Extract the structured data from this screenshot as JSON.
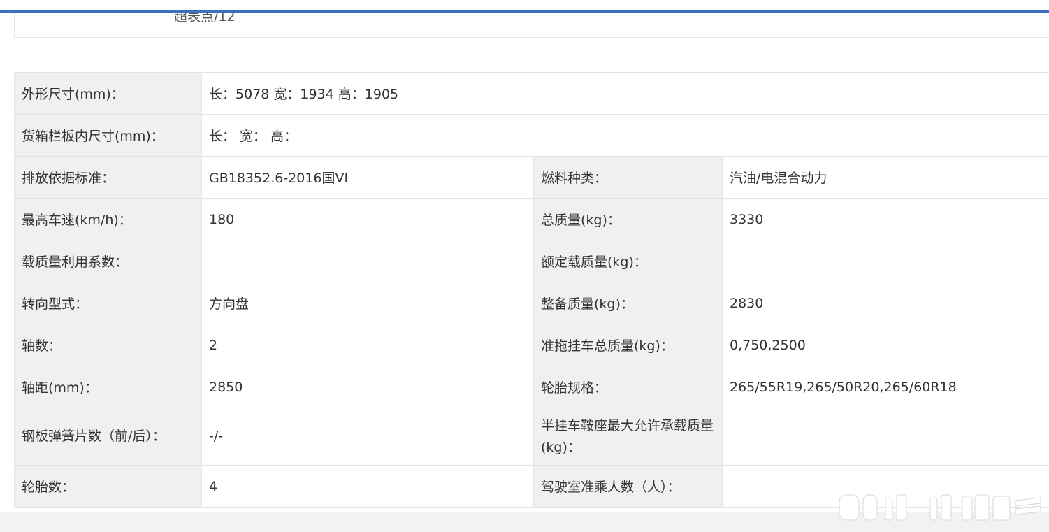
{
  "top_partial_text": "超表点/12",
  "rows": [
    {
      "l1": "外形尺寸(mm)：",
      "v1": "长：5078 宽：1934 高：1905",
      "span": true
    },
    {
      "l1": "货箱栏板内尺寸(mm)：",
      "v1": "长： 宽： 高：",
      "span": true
    },
    {
      "l1": "排放依据标准：",
      "v1": "GB18352.6-2016国VI",
      "l2": "燃料种类：",
      "v2": "汽油/电混合动力"
    },
    {
      "l1": "最高车速(km/h)：",
      "v1": "180",
      "l2": "总质量(kg)：",
      "v2": "3330"
    },
    {
      "l1": "载质量利用系数：",
      "v1": "",
      "l2": "额定载质量(kg)：",
      "v2": ""
    },
    {
      "l1": "转向型式：",
      "v1": "方向盘",
      "l2": "整备质量(kg)：",
      "v2": "2830"
    },
    {
      "l1": "轴数：",
      "v1": "2",
      "l2": "准拖挂车总质量(kg)：",
      "v2": "0,750,2500"
    },
    {
      "l1": "轴距(mm)：",
      "v1": "2850",
      "l2": "轮胎规格：",
      "v2": "265/55R19,265/50R20,265/60R18"
    },
    {
      "l1": "钢板弹簧片数（前/后）：",
      "v1": "-/-",
      "l2": "半挂车鞍座最大允许承载质量(kg)：",
      "v2": ""
    },
    {
      "l1": "轮胎数：",
      "v1": "4",
      "l2": "驾驶室准乘人数（人）：",
      "v2": ""
    }
  ],
  "colors": {
    "accent_bar": "#3a6fc4",
    "label_bg": "#f0f0f0",
    "border": "#e4e4e4"
  }
}
